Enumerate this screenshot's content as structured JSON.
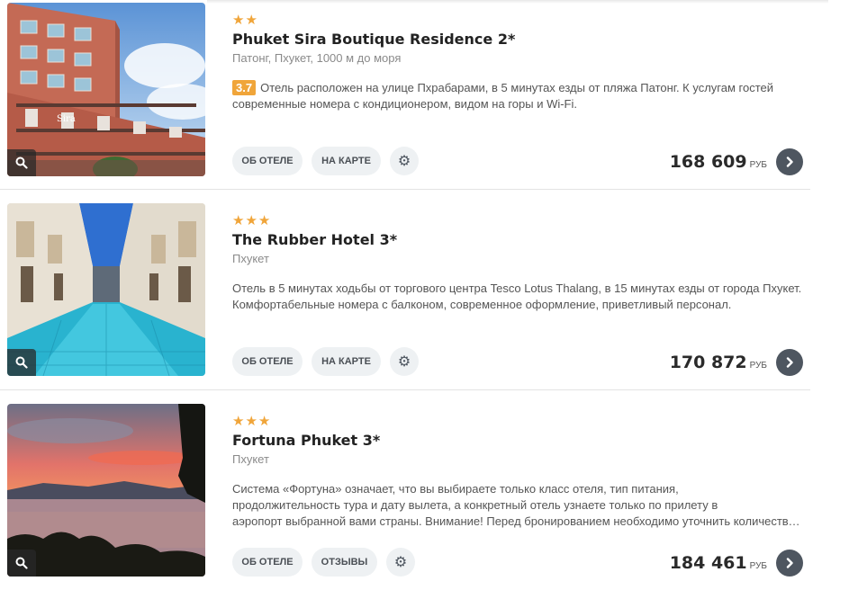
{
  "currency_note": "",
  "hotels": [
    {
      "stars": "★★",
      "name": "Phuket Sira Boutique Residence 2*",
      "location": "Патонг, Пхукет, 1000 м до моря",
      "rating": "3.7",
      "description": "Отель расположен на улице Пхрабарами, в 5 минутах езды от пляжа Патонг. К услугам гостей современные номера с кондиционером, видом на горы и Wi-Fi.",
      "buttons": [
        "ОБ ОТЕЛЕ",
        "НА КАРТЕ"
      ],
      "price": "168 609",
      "currency": "РУБ"
    },
    {
      "stars": "★★★",
      "name": "The Rubber Hotel 3*",
      "location": "Пхукет",
      "rating": "",
      "description": "Отель в 5 минутах ходьбы от торгового центра Tesco Lotus Thalang, в 15 минутах езды от города Пхукет. Комфортабельные номера с балконом, современное оформление, приветливый персонал.",
      "buttons": [
        "ОБ ОТЕЛЕ",
        "НА КАРТЕ"
      ],
      "price": "170 872",
      "currency": "РУБ"
    },
    {
      "stars": "★★★",
      "name": "Fortuna Phuket 3*",
      "location": "Пхукет",
      "rating": "",
      "description_lines": [
        "Система «Фортуна» означает, что вы выбираете только класс отеля, тип питания,",
        "продолжительность тура и дату вылета, а конкретный отель узнаете только по прилету в",
        "аэропорт выбранной вами страны. Внимание! Перед бронированием необходимо уточнить количество мест"
      ],
      "buttons": [
        "ОБ ОТЕЛЕ",
        "ОТЗЫВЫ"
      ],
      "price": "184 461",
      "currency": "РУБ"
    }
  ],
  "colors": {
    "star": "#f0a53a",
    "rating_bg": "#f0a53a",
    "button_bg": "#eef1f3",
    "go_button": "#4e5660"
  },
  "icons": [
    "search-icon",
    "gear-icon",
    "chevron-right-icon"
  ]
}
